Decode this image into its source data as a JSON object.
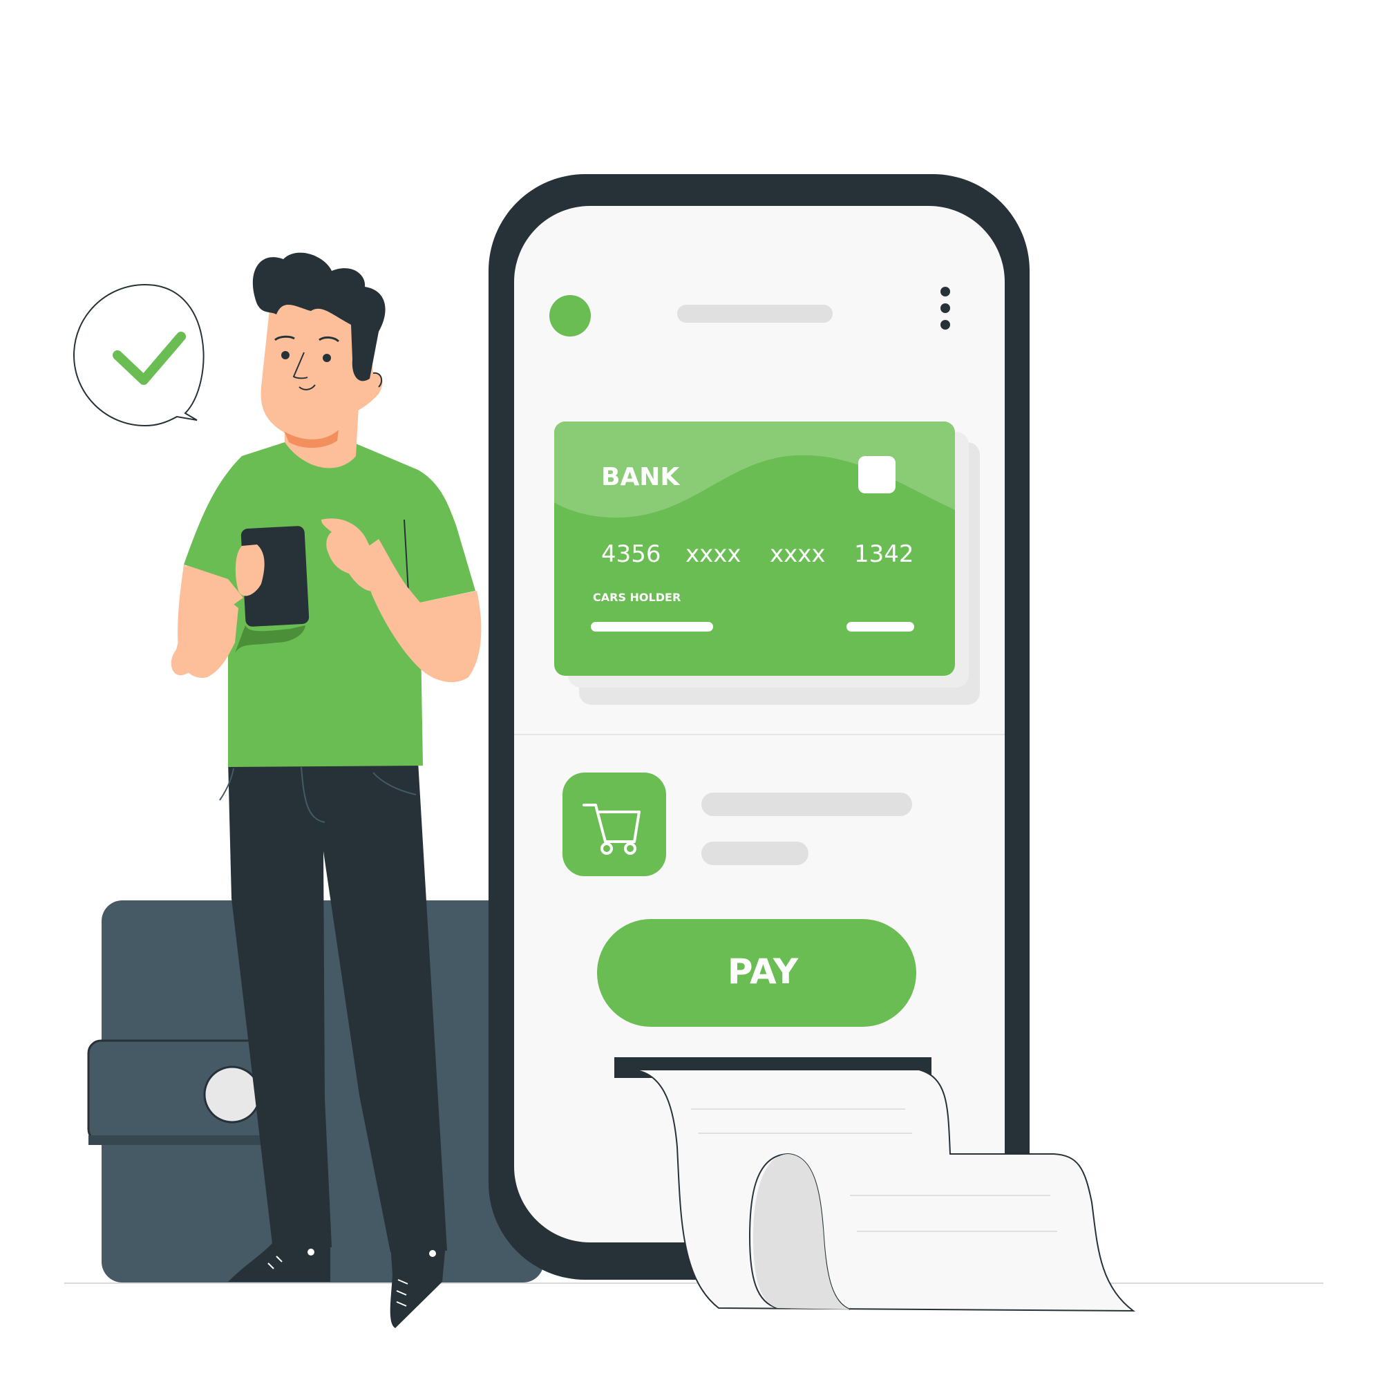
{
  "colors": {
    "accent": "#69BD52",
    "accent_light": "#8ACB76",
    "dark": "#263238",
    "wallet": "#455A64",
    "screen_bg": "#F8F8F8",
    "placeholder": "#E0E0E0",
    "skin": "#FDBF99"
  },
  "icons": {
    "status": "checkmark-icon",
    "menu": "more-vertical-icon",
    "card_chip": "chip-icon",
    "item": "shopping-cart-icon"
  },
  "card": {
    "bank": "BANK",
    "number_groups": [
      "4356",
      "xxxx",
      "xxxx",
      "1342"
    ],
    "holder_label": "CARS HOLDER"
  },
  "actions": {
    "pay_label": "PAY"
  }
}
